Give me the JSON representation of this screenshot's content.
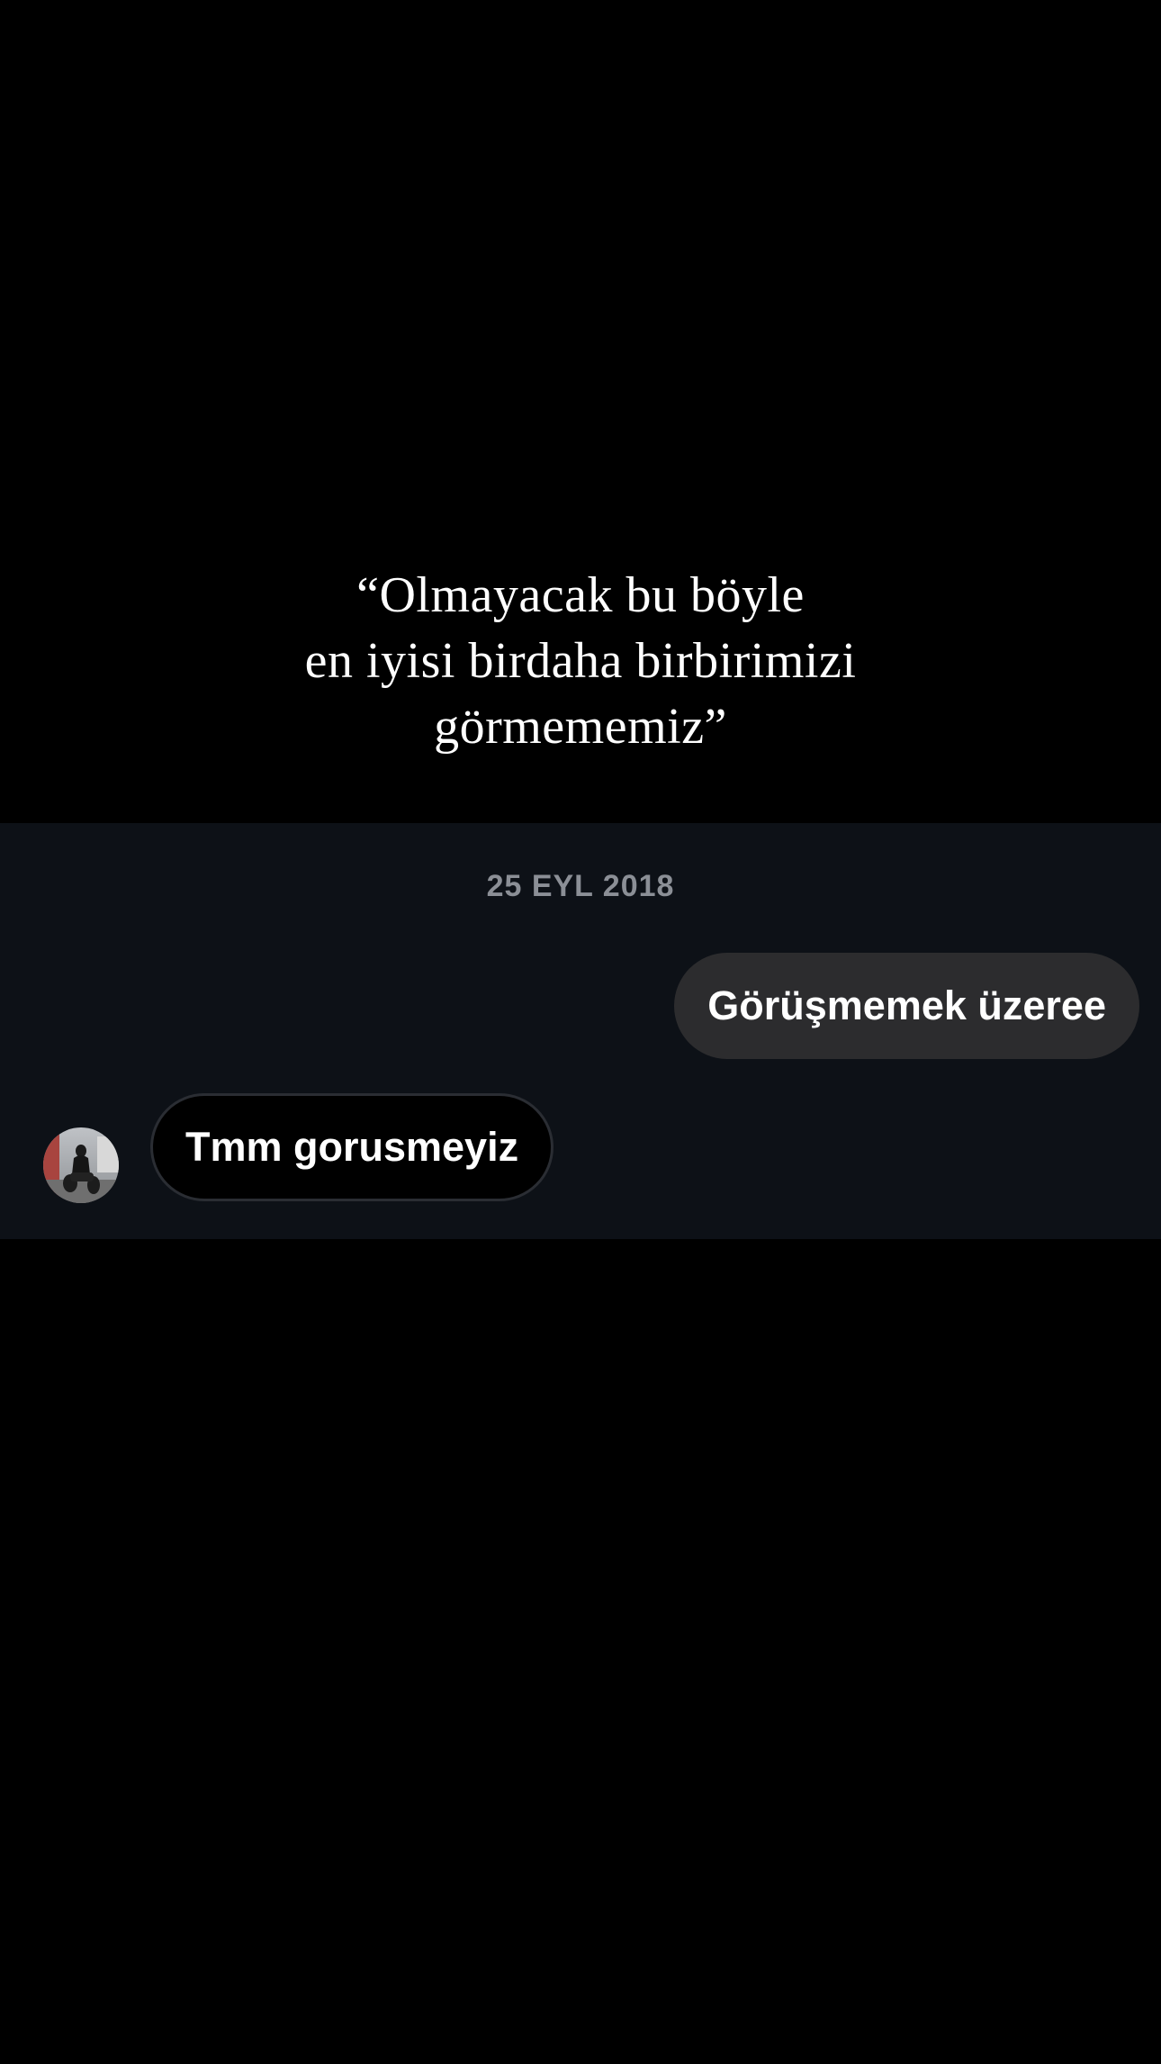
{
  "quote": {
    "line1": "“Olmayacak bu böyle",
    "line2": "en iyisi birdaha birbirimizi",
    "line3": "görmememiz”"
  },
  "chat": {
    "date": "25 EYL 2018",
    "sent_message": "Görüşmemek üzeree",
    "received_message": "Tmm gorusmeyiz",
    "avatar_icon": "user-avatar-photo",
    "colors": {
      "background": "#000000",
      "card_background": "#0d1117",
      "sent_bubble": "#2c2c2e",
      "received_bubble": "#000000",
      "received_border": "#2a2d33",
      "date_text": "#8b8f96",
      "message_text": "#ffffff"
    }
  }
}
